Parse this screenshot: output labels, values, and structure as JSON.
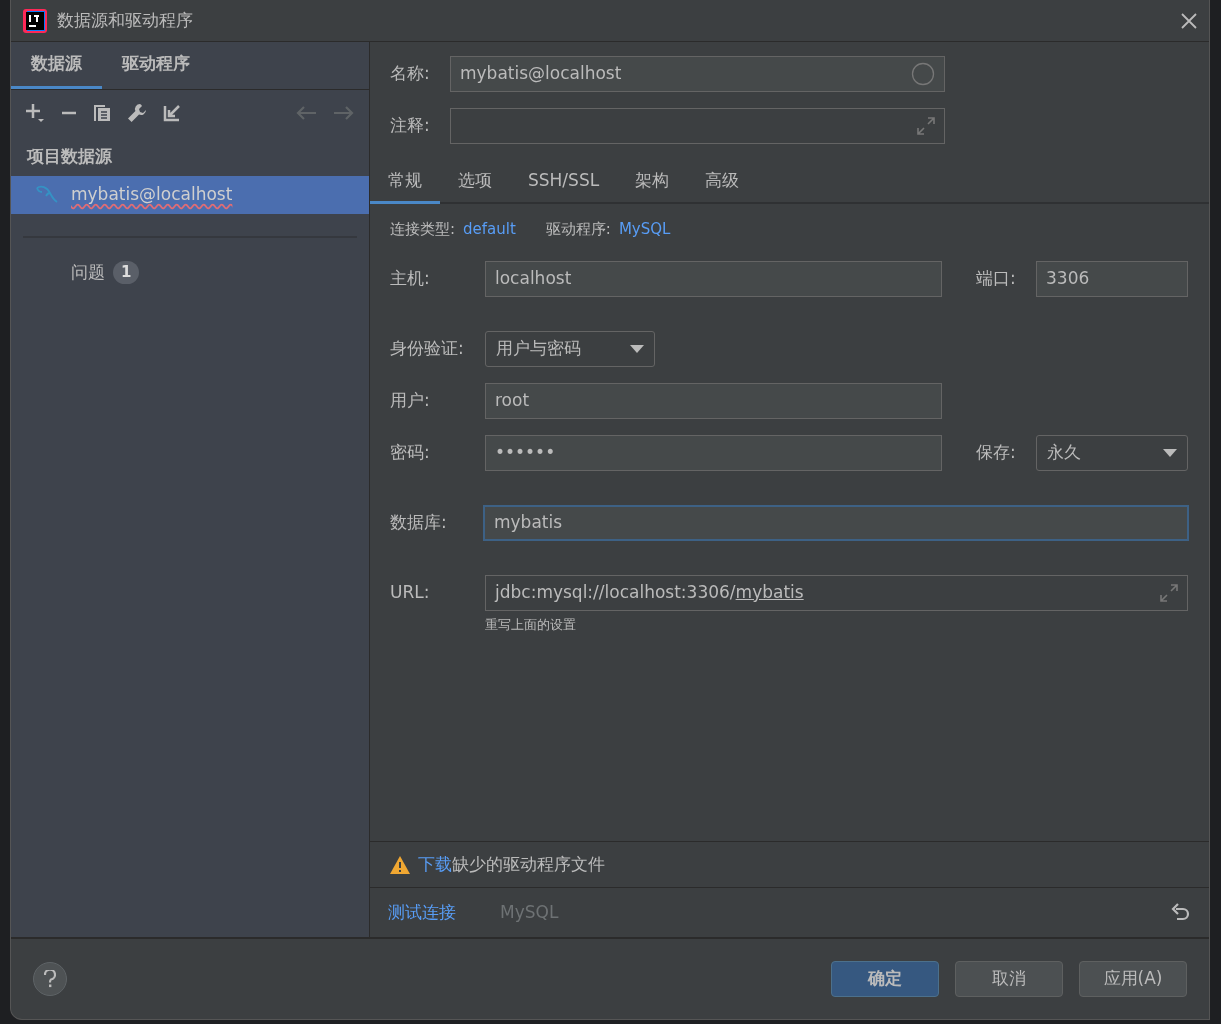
{
  "window": {
    "title": "数据源和驱动程序"
  },
  "sidebar": {
    "tabs": [
      {
        "label": "数据源",
        "selected": true
      },
      {
        "label": "驱动程序",
        "selected": false
      }
    ],
    "section_title": "项目数据源",
    "items": [
      {
        "label": "mybatis@localhost",
        "selected": true
      }
    ],
    "problems": {
      "label": "问题",
      "count": "1"
    }
  },
  "form": {
    "name": {
      "label": "名称:",
      "value": "mybatis@localhost"
    },
    "comment": {
      "label": "注释:"
    },
    "tabs": [
      {
        "label": "常规",
        "selected": true
      },
      {
        "label": "选项",
        "selected": false
      },
      {
        "label": "SSH/SSL",
        "selected": false
      },
      {
        "label": "架构",
        "selected": false
      },
      {
        "label": "高级",
        "selected": false
      }
    ],
    "connection_type": {
      "label": "连接类型:",
      "value": "default"
    },
    "driver": {
      "label": "驱动程序:",
      "value": "MySQL"
    },
    "host": {
      "label": "主机:",
      "value": "localhost"
    },
    "port": {
      "label": "端口:",
      "value": "3306"
    },
    "auth": {
      "label": "身份验证:",
      "value": "用户与密码"
    },
    "user": {
      "label": "用户:",
      "value": "root"
    },
    "password": {
      "label": "密码:",
      "value": "••••••"
    },
    "save": {
      "label": "保存:",
      "value": "永久"
    },
    "database": {
      "label": "数据库:",
      "value": "mybatis",
      "focused": true
    },
    "url": {
      "label": "URL:",
      "prefix": "jdbc:mysql://localhost:3306/",
      "database_part": "mybatis",
      "hint": "重写上面的设置"
    }
  },
  "warning": {
    "link": "下载",
    "text": "缺少的驱动程序文件"
  },
  "bottom_bar": {
    "test_connection": "测试连接",
    "driver_name": "MySQL"
  },
  "buttons": [
    {
      "label": "确定",
      "primary": true
    },
    {
      "label": "取消",
      "primary": false
    },
    {
      "label": "应用(A)",
      "primary": false
    }
  ]
}
